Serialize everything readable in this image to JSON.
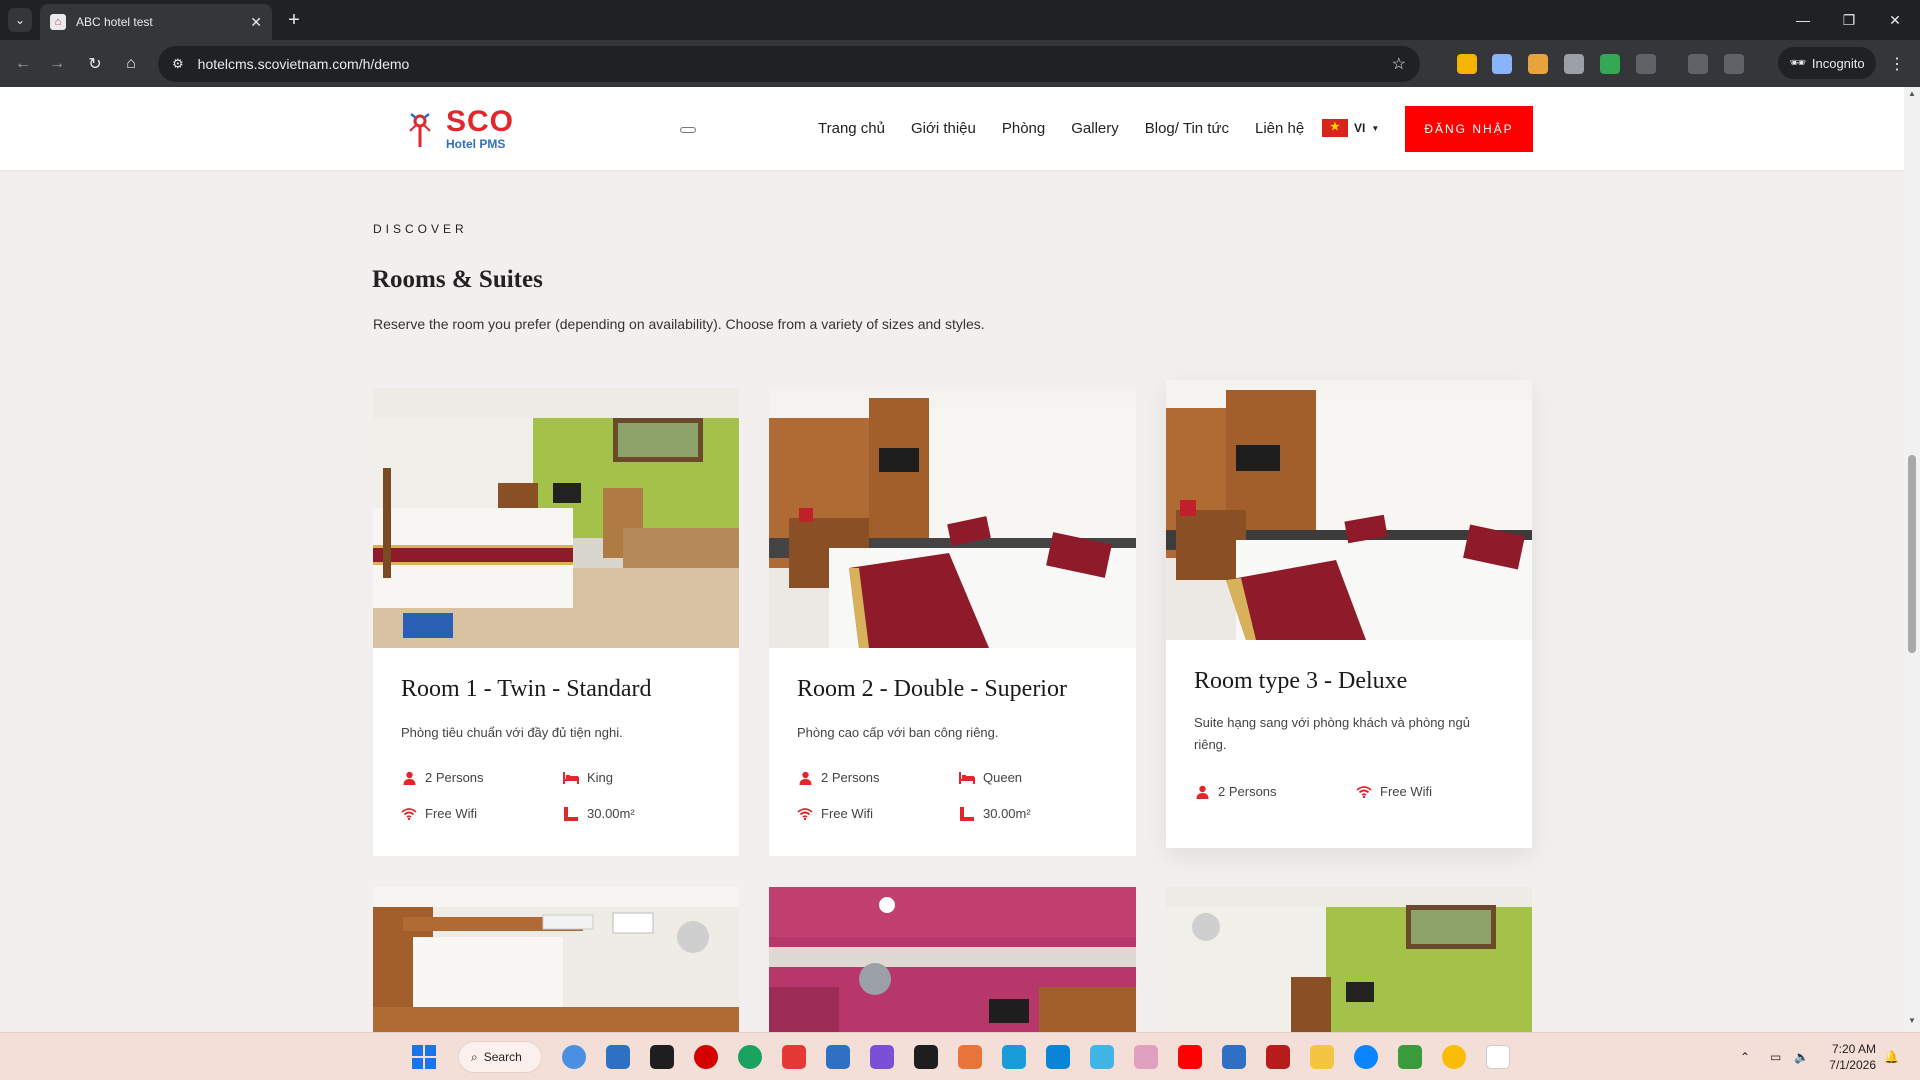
{
  "browser": {
    "tab_title": "ABC hotel test",
    "url": "hotelcms.scovietnam.com/h/demo",
    "incognito_label": "Incognito"
  },
  "header": {
    "brand": "SCO",
    "brand_sub": "Hotel PMS",
    "nav": [
      "Trang chủ",
      "Giới thiệu",
      "Phòng",
      "Gallery",
      "Blog/ Tin tức",
      "Liên hệ"
    ],
    "language": "VI",
    "login_label": "ĐĂNG NHẬP",
    "accent_color": "#ff0000"
  },
  "section": {
    "eyebrow": "DISCOVER",
    "title": "Rooms & Suites",
    "description": "Reserve the room you prefer (depending on availability). Choose from a variety of sizes and styles."
  },
  "rooms": [
    {
      "name": "Room 1 - Twin - Standard",
      "description": "Phòng tiêu chuẩn với đầy đủ tiện nghi.",
      "persons": "2 Persons",
      "bed": "King",
      "wifi": "Free Wifi",
      "area": "30.00m²"
    },
    {
      "name": "Room 2 - Double - Superior",
      "description": "Phòng cao cấp với ban công riêng.",
      "persons": "2 Persons",
      "bed": "Queen",
      "wifi": "Free Wifi",
      "area": "30.00m²"
    },
    {
      "name": "Room type 3 - Deluxe",
      "description": "Suite hạng sang với phòng khách và phòng ngủ riêng.",
      "persons": "2 Persons",
      "wifi": "Free Wifi"
    }
  ],
  "taskbar": {
    "search_label": "Search",
    "time": "7:20 AM",
    "date": "7/1/2026"
  }
}
